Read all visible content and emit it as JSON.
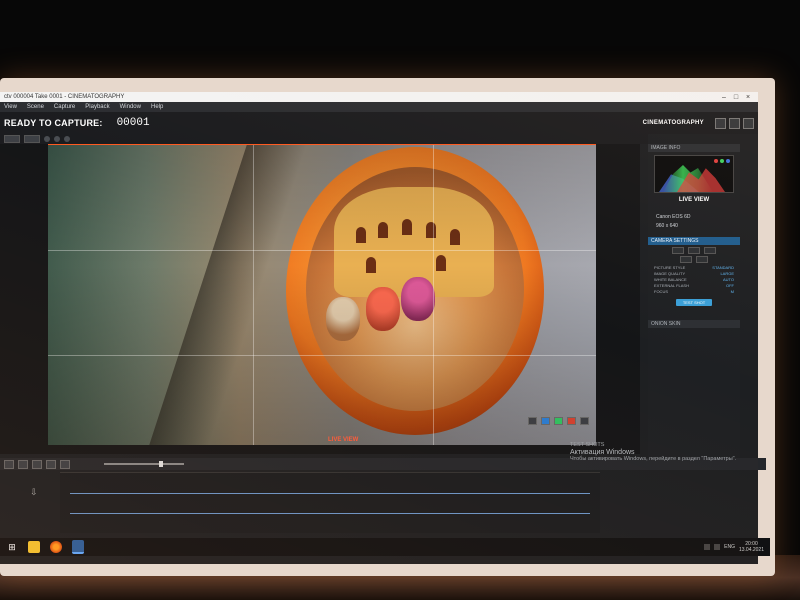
{
  "window": {
    "title": "ctv 000004 Take 0001 - CINEMATOGRAPHY"
  },
  "menu": {
    "items": [
      "View",
      "Scene",
      "Capture",
      "Playback",
      "Window",
      "Help"
    ]
  },
  "capture": {
    "status_label": "READY TO CAPTURE:",
    "frame_number": "00001"
  },
  "app": {
    "logo_text": "CINEMATOGRAPHY"
  },
  "live_view": {
    "caption": "LIVE VIEW"
  },
  "right_panel": {
    "histogram_header": "IMAGE INFO",
    "live_view_title": "LIVE VIEW",
    "camera_name": "Canon EOS 6D",
    "resolution": "960 x 640",
    "settings_header": "CAMERA SETTINGS",
    "settings": [
      {
        "label": "PICTURE STYLE",
        "value": "STANDARD"
      },
      {
        "label": "IMAGE QUALITY",
        "value": "LARGE"
      },
      {
        "label": "WHITE BALANCE",
        "value": "AUTO"
      },
      {
        "label": "EXTERNAL FLASH",
        "value": "OFF"
      },
      {
        "label": "FOCUS",
        "value": "M"
      }
    ],
    "capture_button": "TEST SHOT",
    "onion_header": "ONION SKIN"
  },
  "activation": {
    "line1": "TEST SHOTS",
    "line2": "Активация Windows",
    "line3": "Чтобы активировать Windows, перейдите в раздел \"Параметры\"."
  },
  "taskbar": {
    "start_glyph": "⊞",
    "time": "20:00",
    "date": "13.04.2021",
    "lang": "ENG"
  },
  "colors": {
    "accent": "#ff5a20",
    "panel_blue": "#1f5d8f",
    "button_blue": "#3aa0d8"
  }
}
